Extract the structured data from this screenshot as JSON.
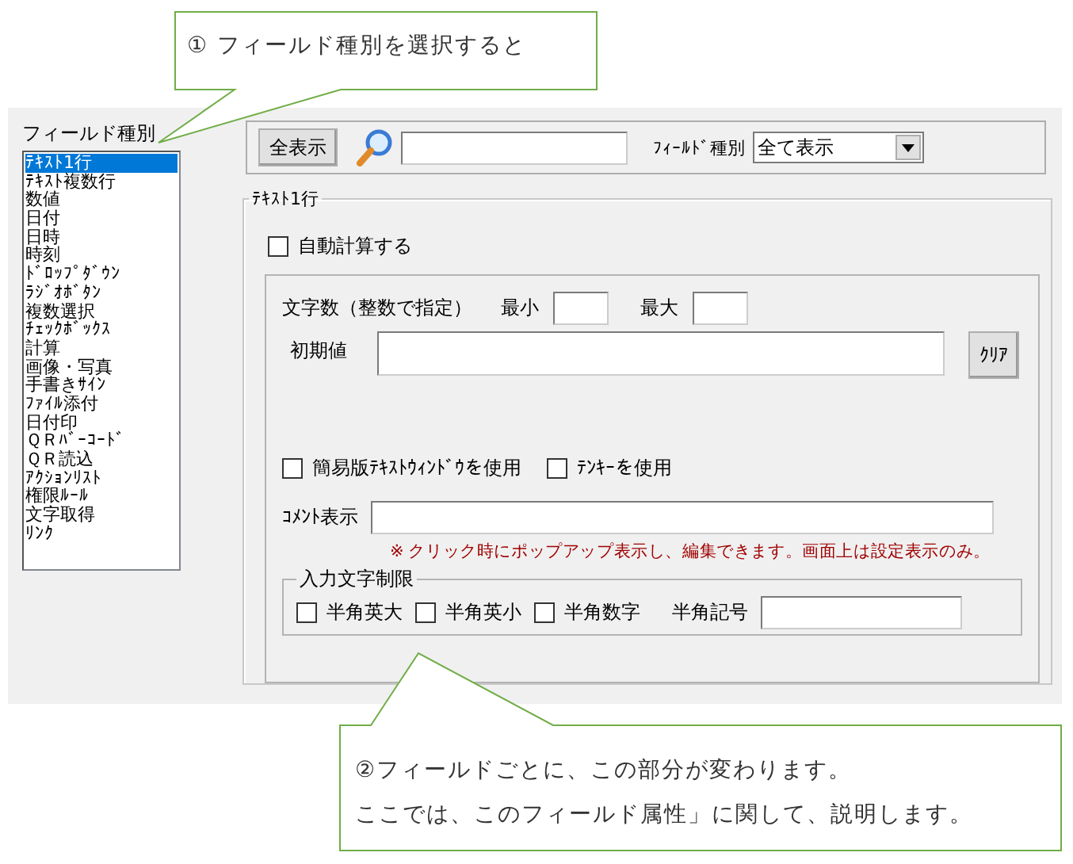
{
  "field_type_panel": {
    "label": "フィールド種別",
    "items": [
      {
        "label": "ﾃｷｽﾄ1行",
        "selected": true
      },
      {
        "label": "ﾃｷｽﾄ複数行",
        "selected": false
      },
      {
        "label": "数値",
        "selected": false
      },
      {
        "label": "日付",
        "selected": false
      },
      {
        "label": "日時",
        "selected": false
      },
      {
        "label": "時刻",
        "selected": false
      },
      {
        "label": "ﾄﾞﾛｯﾌﾟﾀﾞｳﾝ",
        "selected": false
      },
      {
        "label": "ﾗｼﾞｵﾎﾞﾀﾝ",
        "selected": false
      },
      {
        "label": "複数選択",
        "selected": false
      },
      {
        "label": "ﾁｪｯｸﾎﾞｯｸｽ",
        "selected": false
      },
      {
        "label": "計算",
        "selected": false
      },
      {
        "label": "画像・写真",
        "selected": false
      },
      {
        "label": "手書きｻｲﾝ",
        "selected": false
      },
      {
        "label": "ﾌｧｲﾙ添付",
        "selected": false
      },
      {
        "label": "日付印",
        "selected": false
      },
      {
        "label": "ＱＲﾊﾞｰｺｰﾄﾞ",
        "selected": false
      },
      {
        "label": "ＱＲ読込",
        "selected": false
      },
      {
        "label": "ｱｸｼｮﾝﾘｽﾄ",
        "selected": false
      },
      {
        "label": "権限ﾙｰﾙ",
        "selected": false
      },
      {
        "label": "文字取得",
        "selected": false
      },
      {
        "label": "ﾘﾝｸ",
        "selected": false
      }
    ]
  },
  "toolbar": {
    "show_all_button": "全表示",
    "filter_label": "ﾌｨｰﾙﾄﾞ種別",
    "filter_value": "全て表示"
  },
  "settings_group": {
    "title": "ﾃｷｽﾄ1行",
    "auto_calc": {
      "label": "自動計算する",
      "checked": false
    },
    "char_count_label": "文字数（整数で指定）",
    "min_label": "最小",
    "max_label": "最大",
    "initial_value_label": "初期値",
    "clear_button": "ｸﾘｱ",
    "options": [
      {
        "label": "簡易版ﾃｷｽﾄｳｨﾝﾄﾞｳを使用",
        "checked": false
      },
      {
        "label": "ﾃﾝｷｰを使用",
        "checked": false
      }
    ],
    "comment_label": "ｺﾒﾝﾄ表示",
    "comment_note": "※ クリック時にポップアップ表示し、編集できます。画面上は設定表示のみ。",
    "restriction": {
      "title": "入力文字制限",
      "checkboxes": [
        {
          "label": "半角英大",
          "checked": false
        },
        {
          "label": "半角英小",
          "checked": false
        },
        {
          "label": "半角数字",
          "checked": false
        }
      ],
      "symbol_label": "半角記号"
    }
  },
  "callouts": [
    {
      "lines": [
        "① フィールド種別を選択すると"
      ]
    },
    {
      "lines": [
        "②フィールドごとに、この部分が変わります。",
        "ここでは、このフィールド属性」に関して、説明します。"
      ]
    }
  ]
}
